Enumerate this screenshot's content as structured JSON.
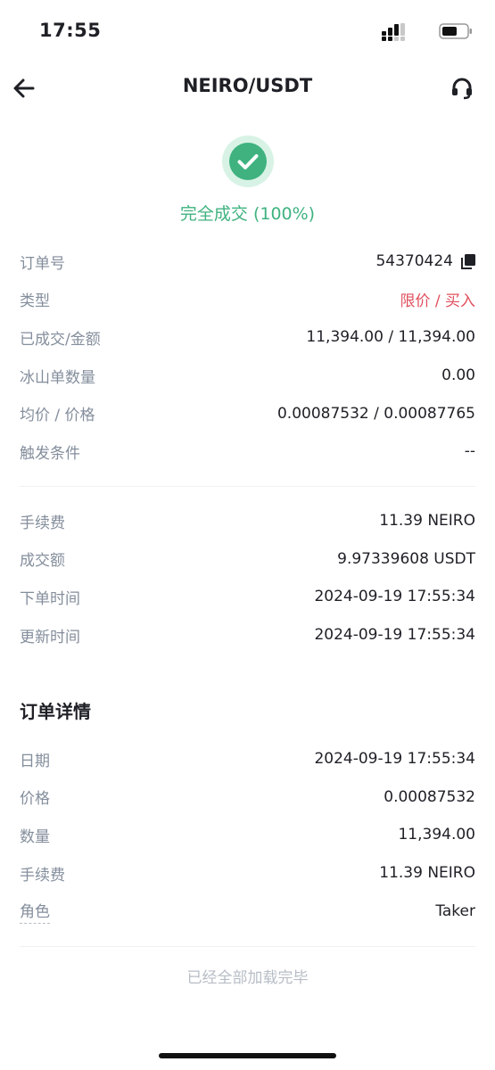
{
  "status_bar": {
    "time": "17:55",
    "icons": [
      "signal-icon",
      "battery-icon"
    ]
  },
  "nav": {
    "title": "NEIRO/USDT",
    "icons": [
      "back-arrow-icon",
      "headset-icon"
    ]
  },
  "status": {
    "icon": "check-circle-icon",
    "text": "完全成交 (100%)",
    "color": "#3fb27f"
  },
  "order_info": [
    {
      "label": "订单号",
      "value": "54370424"
    },
    {
      "label": "类型",
      "value": "限价 / 买入"
    },
    {
      "label": "已成交/金额",
      "value": "11,394.00 / 11,394.00"
    },
    {
      "label": "冰山单数量",
      "value": "0.00"
    },
    {
      "label": "均价 / 价格",
      "value": "0.00087532 / 0.00087765"
    },
    {
      "label": "触发条件",
      "value": "--"
    }
  ],
  "fee_info": [
    {
      "label": "手续费",
      "value": "11.39 NEIRO"
    },
    {
      "label": "成交额",
      "value": "9.97339608 USDT"
    },
    {
      "label": "下单时间",
      "value": "2024-09-19 17:55:34"
    },
    {
      "label": "更新时间",
      "value": "2024-09-19 17:55:34"
    }
  ],
  "details": {
    "title": "订单详情",
    "rows": [
      {
        "label": "日期",
        "value": "2024-09-19 17:55:34"
      },
      {
        "label": "价格",
        "value": "0.00087532"
      },
      {
        "label": "数量",
        "value": "11,394.00"
      },
      {
        "label": "手续费",
        "value": "11.39 NEIRO"
      },
      {
        "label": "角色",
        "value": "Taker"
      }
    ]
  },
  "footer": {
    "text": "已经全部加载完毕"
  },
  "colors": {
    "success": "#3fb27f",
    "sell_buy_red": "#e0505f",
    "label_gray": "#848e9c"
  }
}
